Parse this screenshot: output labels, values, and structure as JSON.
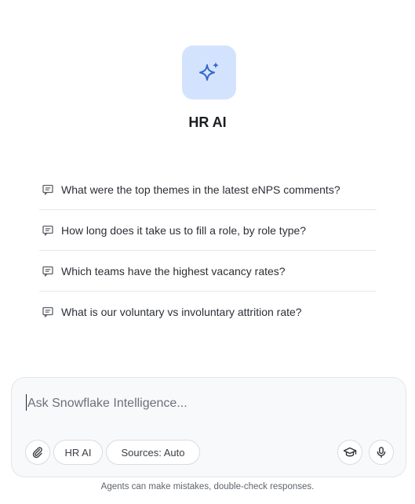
{
  "agent": {
    "name": "HR AI",
    "icon": "sparkle-icon",
    "tile_color": "#d4e3fd",
    "accent_color": "#3367c9"
  },
  "suggestions": [
    {
      "icon": "message-icon",
      "text": "What were the top themes in the latest eNPS comments?"
    },
    {
      "icon": "message-icon",
      "text": "How long does it take us to fill a role, by role type?"
    },
    {
      "icon": "message-icon",
      "text": "Which teams have the highest vacancy rates?"
    },
    {
      "icon": "message-icon",
      "text": "What is our voluntary vs involuntary attrition rate?"
    }
  ],
  "composer": {
    "placeholder": "Ask Snowflake Intelligence...",
    "value": "",
    "attach_icon": "paperclip-icon",
    "agent_chip_label": "HR AI",
    "sources_chip_label": "Sources: Auto",
    "research_icon": "graduation-cap-icon",
    "mic_icon": "microphone-icon"
  },
  "footer": {
    "disclaimer": "Agents can make mistakes, double-check responses."
  }
}
